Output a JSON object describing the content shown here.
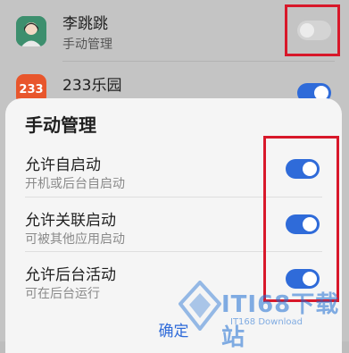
{
  "apps": [
    {
      "name": "李跳跳",
      "subtitle": "手动管理",
      "icon": "avatar-icon",
      "toggle": "off"
    },
    {
      "name": "233乐园",
      "subtitle": "",
      "icon": "app-233-icon",
      "icon_text": "233",
      "toggle": "on"
    }
  ],
  "sheet": {
    "title": "手动管理",
    "options": [
      {
        "title": "允许自启动",
        "desc": "开机或后台自启动",
        "enabled": true
      },
      {
        "title": "允许关联启动",
        "desc": "可被其他应用启动",
        "enabled": true
      },
      {
        "title": "允许后台活动",
        "desc": "可在后台运行",
        "enabled": true
      }
    ],
    "confirm_label": "确定"
  },
  "watermark": {
    "text": "ITI68下载站",
    "sub": "IT168 Download"
  },
  "colors": {
    "accent": "#2f6bd9",
    "annotation": "#d8182a"
  }
}
